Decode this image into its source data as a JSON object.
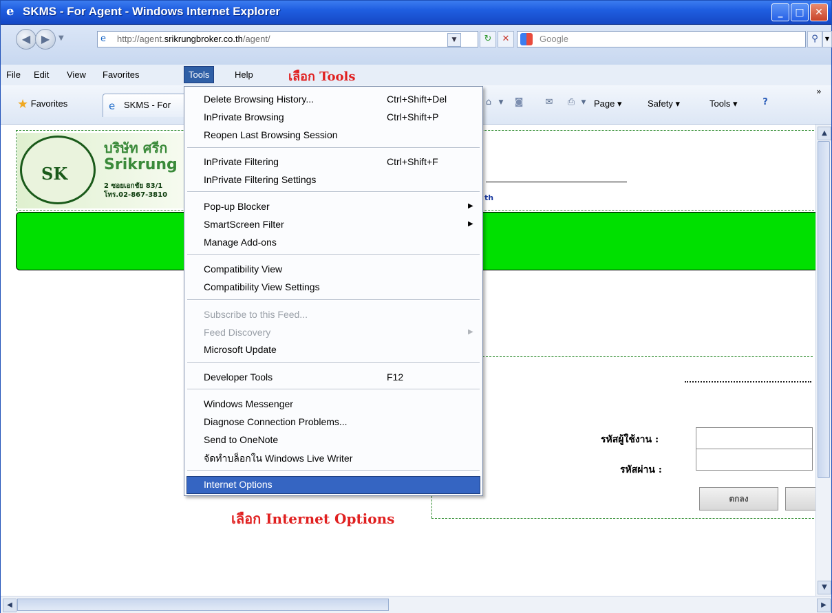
{
  "window": {
    "title": "SKMS - For Agent - Windows Internet Explorer",
    "title_icon": "ie-icon",
    "controls": {
      "minimize": "_",
      "maximize": "□",
      "close": "✕"
    }
  },
  "address_bar": {
    "url_prefix": "http://agent.",
    "url_domain": "srikrungbroker.co.th",
    "url_suffix": "/agent/",
    "search_placeholder": "Google"
  },
  "menu_bar": {
    "items": [
      "File",
      "Edit",
      "View",
      "Favorites",
      "Tools",
      "Help"
    ],
    "active": "Tools"
  },
  "annotations": {
    "select_tools": "เลือก Tools",
    "select_internet_options": "เลือก Internet Options"
  },
  "favorites_bar": {
    "favorites_label": "Favorites",
    "tab_label": "SKMS - For",
    "commands": [
      "Page",
      "Safety",
      "Tools"
    ]
  },
  "tools_menu": {
    "items": [
      {
        "label": "Delete Browsing History...",
        "shortcut": "Ctrl+Shift+Del"
      },
      {
        "label": "InPrivate Browsing",
        "shortcut": "Ctrl+Shift+P"
      },
      {
        "label": "Reopen Last Browsing Session"
      },
      {
        "label": "InPrivate Filtering",
        "shortcut": "Ctrl+Shift+F"
      },
      {
        "label": "InPrivate Filtering Settings"
      },
      {
        "label": "Pop-up Blocker",
        "submenu": true
      },
      {
        "label": "SmartScreen Filter",
        "submenu": true
      },
      {
        "label": "Manage Add-ons"
      },
      {
        "label": "Compatibility View"
      },
      {
        "label": "Compatibility View Settings"
      },
      {
        "label": "Subscribe to this Feed...",
        "disabled": true
      },
      {
        "label": "Feed Discovery",
        "disabled": true,
        "submenu": true
      },
      {
        "label": "Microsoft Update"
      },
      {
        "label": "Developer Tools",
        "shortcut": "F12"
      },
      {
        "label": "Windows Messenger"
      },
      {
        "label": "Diagnose Connection Problems..."
      },
      {
        "label": "Send to OneNote"
      },
      {
        "label": "จัดทำบล็อกใน Windows Live Writer"
      },
      {
        "label": "Internet Options",
        "highlighted": true
      }
    ]
  },
  "page": {
    "company_thai": "บริษัท ศรีก",
    "company_en": "Srikrung",
    "address_line": "2 ซอยเอกชัย 83/1",
    "phone_line": "โทร.02-867-3810",
    "header_suffix": "th",
    "logo_text": "SK",
    "username_label": "รหัสผู้ใช้งาน :",
    "password_label": "รหัสผ่าน :",
    "ok_button": "ตกลง"
  },
  "colors": {
    "titlebar": "#1f5ee0",
    "menu_highlight": "#3565c2",
    "annotation": "#e02020",
    "green_band": "#00e000"
  }
}
